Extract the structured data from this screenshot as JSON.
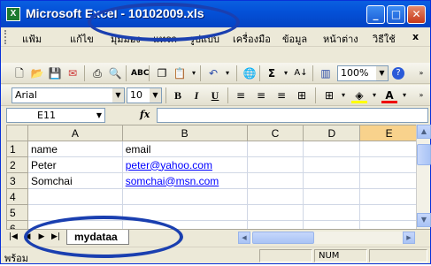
{
  "window": {
    "title": "Microsoft Excel - 10102009.xls",
    "app_icon": "X",
    "buttons": {
      "minimize": "_",
      "maximize": "□",
      "close": "✕"
    }
  },
  "menu": {
    "items": [
      "แฟ้ม",
      "แก้ไข",
      "มุมมอง",
      "แทรก",
      "รูปแบบ",
      "เครื่องมือ",
      "ข้อมูล",
      "หน้าต่าง",
      "วิธีใช้"
    ],
    "close_icon": "x"
  },
  "toolbar_standard": {
    "zoom": "100%",
    "icons": [
      "new-icon",
      "open-icon",
      "save-icon",
      "permission-icon",
      "print-icon",
      "print-preview-icon",
      "spelling-icon",
      "cut-icon",
      "copy-icon",
      "paste-icon",
      "undo-icon",
      "hyperlink-icon",
      "autosum-icon",
      "sort-icon",
      "chart-icon",
      "help-icon"
    ]
  },
  "toolbar_format": {
    "font": "Arial",
    "size": "10",
    "bold": "B",
    "italic": "I",
    "underline": "U"
  },
  "formula_bar": {
    "name_box": "E11",
    "fx": "fx",
    "value": ""
  },
  "sheet": {
    "columns": [
      "A",
      "B",
      "C",
      "D",
      "E"
    ],
    "selected_column": "E",
    "rows": [
      {
        "num": "1",
        "cells": [
          "name",
          "email",
          "",
          "",
          ""
        ]
      },
      {
        "num": "2",
        "cells": [
          "Peter",
          "peter@yahoo.com",
          "",
          "",
          ""
        ]
      },
      {
        "num": "3",
        "cells": [
          "Somchai",
          "somchai@msn.com",
          "",
          "",
          ""
        ]
      },
      {
        "num": "4",
        "cells": [
          "",
          "",
          "",
          "",
          ""
        ]
      },
      {
        "num": "5",
        "cells": [
          "",
          "",
          "",
          "",
          ""
        ]
      },
      {
        "num": "6",
        "cells": [
          "",
          "",
          "",
          "",
          ""
        ]
      }
    ]
  },
  "tabs": {
    "active": "mydataa"
  },
  "status": {
    "ready": "พร้อม",
    "num": "NUM"
  },
  "colors": {
    "titlebar": "#0451d8",
    "selected_header": "#f8d28c",
    "link": "#0000ff",
    "annotation": "#1a3fb0"
  }
}
